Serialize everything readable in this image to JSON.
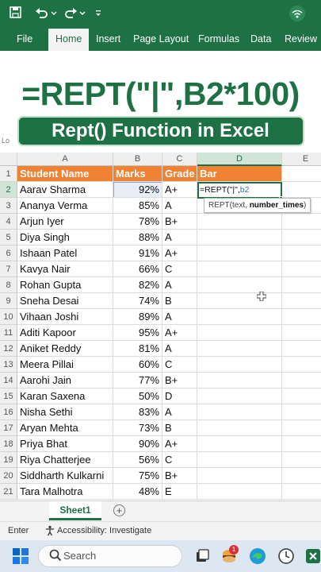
{
  "ribbon": {
    "tabs": [
      "File",
      "Home",
      "Insert",
      "Page Layout",
      "Formulas",
      "Data",
      "Review"
    ],
    "active": "Home"
  },
  "banner": {
    "formula": "=REPT(\"|\",B2*100)",
    "title": "Rept() Function in Excel",
    "namebox_peek": "Lo"
  },
  "grid": {
    "columns": [
      "A",
      "B",
      "C",
      "D",
      "E"
    ],
    "header_row": [
      "Student Name",
      "Marks",
      "Grade",
      "Bar"
    ],
    "rows": [
      [
        "Aarav Sharma",
        "92%",
        "A+"
      ],
      [
        "Ananya Verma",
        "85%",
        "A"
      ],
      [
        "Arjun Iyer",
        "78%",
        "B+"
      ],
      [
        "Diya Singh",
        "88%",
        "A"
      ],
      [
        "Ishaan Patel",
        "91%",
        "A+"
      ],
      [
        "Kavya Nair",
        "66%",
        "C"
      ],
      [
        "Rohan Gupta",
        "82%",
        "A"
      ],
      [
        "Sneha Desai",
        "74%",
        "B"
      ],
      [
        "Vihaan Joshi",
        "89%",
        "A"
      ],
      [
        "Aditi Kapoor",
        "95%",
        "A+"
      ],
      [
        "Aniket Reddy",
        "81%",
        "A"
      ],
      [
        "Meera Pillai",
        "60%",
        "C"
      ],
      [
        "Aarohi Jain",
        "77%",
        "B+"
      ],
      [
        "Karan Saxena",
        "50%",
        "D"
      ],
      [
        "Nisha Sethi",
        "83%",
        "A"
      ],
      [
        "Aryan Mehta",
        "73%",
        "B"
      ],
      [
        "Priya Bhat",
        "90%",
        "A+"
      ],
      [
        "Riya Chatterjee",
        "56%",
        "C"
      ],
      [
        "Siddharth Kulkarni",
        "75%",
        "B+"
      ],
      [
        "Tara Malhotra",
        "48%",
        "E"
      ]
    ],
    "editing": {
      "prefix": "=REPT(\"|\",",
      "ref": "b2"
    },
    "tooltip": {
      "func": "REPT(text, ",
      "arg": "number_times",
      "end": ")"
    }
  },
  "sheets": {
    "active": "Sheet1",
    "add": "+"
  },
  "status": {
    "mode": "Enter",
    "accessibility": "Accessibility: Investigate"
  },
  "taskbar": {
    "search_placeholder": "Search",
    "badge_count": "1"
  },
  "colors": {
    "excel_green": "#1e7145",
    "header_orange": "#f08233"
  }
}
